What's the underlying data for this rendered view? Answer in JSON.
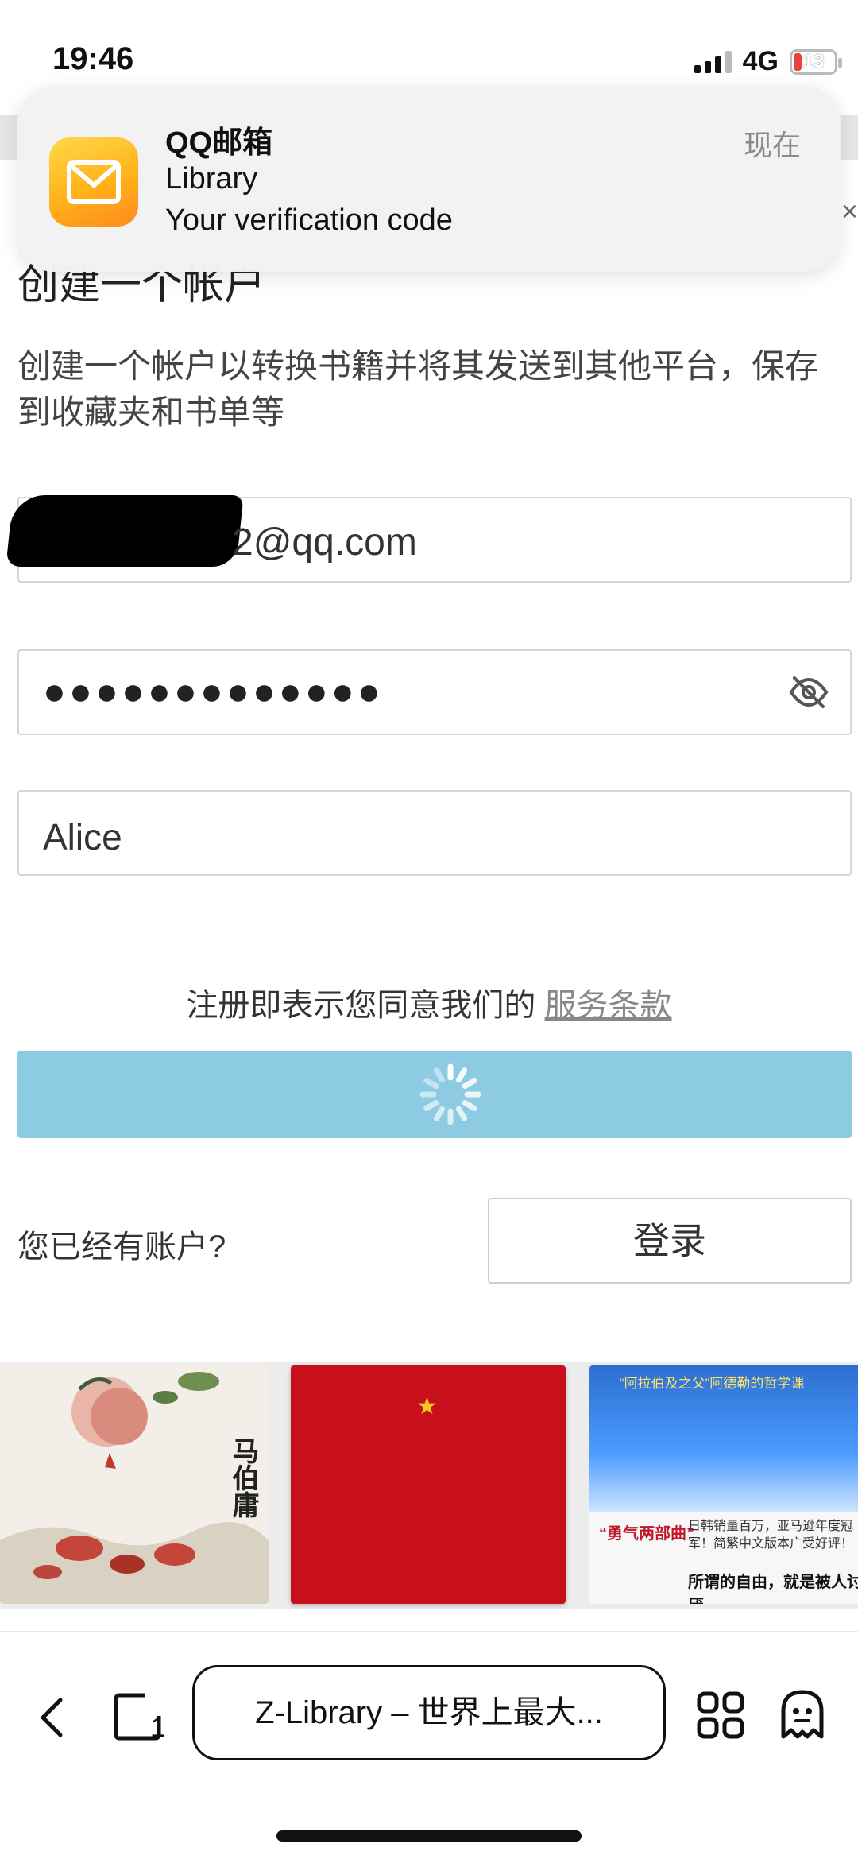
{
  "status_bar": {
    "time": "19:46",
    "network": "4G",
    "battery": "13"
  },
  "notification": {
    "app": "QQ邮箱",
    "title": "Library",
    "body": "Your verification code",
    "time": "现在",
    "icon": "envelope-icon"
  },
  "page": {
    "title": "创建一个帐户",
    "subtitle": "创建一个帐户以转换书籍并将其发送到其他平台，保存到收藏夹和书单等"
  },
  "form": {
    "email_value": "2@qq.com",
    "password_value": "●●●●●●●●●●●●●",
    "name_value": "Alice",
    "terms_text": "注册即表示您同意我们的",
    "terms_link": "服务条款",
    "submit_state": "loading",
    "submit_color": "#8ccbe1"
  },
  "login": {
    "prompt": "您已经有账户?",
    "button_label": "登录"
  },
  "books": [
    {
      "author": "马伯庸"
    },
    {
      "emblem": "★"
    },
    {
      "tag": "“阿拉伯及之父”阿德勒的哲学课",
      "badge": "“勇气两部曲”",
      "text": "日韩销量百万，亚马逊年度冠军！简繁中文版本广受好评！",
      "motto": "所谓的自由，就是被人讨厌"
    }
  ],
  "toolbar": {
    "url_text": "Z-Library – 世界上最大...",
    "tab_count": "1"
  }
}
